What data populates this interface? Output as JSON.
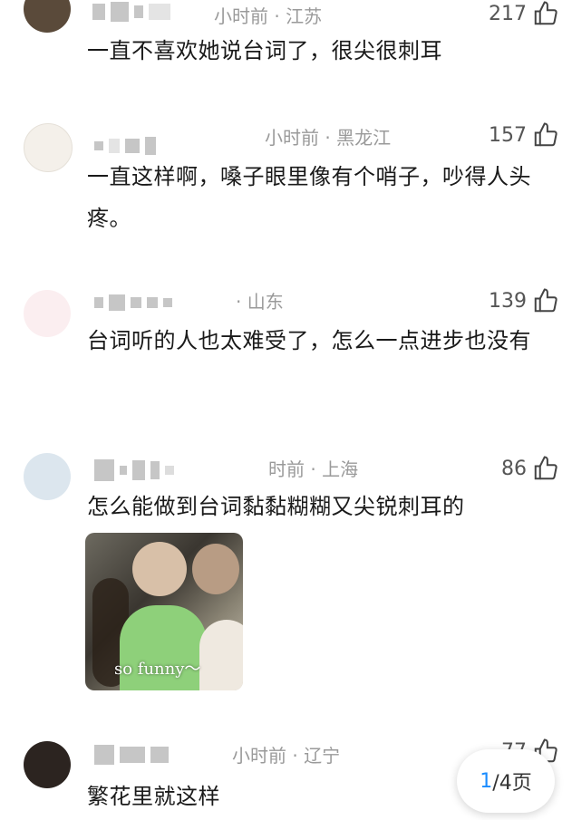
{
  "comments": [
    {
      "meta": "小时前 · 江苏",
      "likes": "217",
      "text": "一直不喜欢她说台词了，很尖很刺耳"
    },
    {
      "meta": "小时前 · 黑龙江",
      "likes": "157",
      "text": "一直这样啊，嗓子眼里像有个哨子，吵得人头疼。"
    },
    {
      "meta": "· 山东",
      "likes": "139",
      "text": "台词听的人也太难受了，怎么一点进步也没有"
    },
    {
      "meta": "时前 · 上海",
      "likes": "86",
      "text": "怎么能做到台词黏黏糊糊又尖锐刺耳的",
      "media_caption": "so funny～"
    },
    {
      "meta": "小时前 · 辽宁",
      "likes": "77",
      "text": "繁花里就这样"
    }
  ],
  "pager": {
    "current": "1",
    "rest": "/4页"
  },
  "colors": {
    "accent": "#1a8cff",
    "meta": "#9a9a9a"
  },
  "icons": {
    "like": "thumbs-up-icon"
  }
}
